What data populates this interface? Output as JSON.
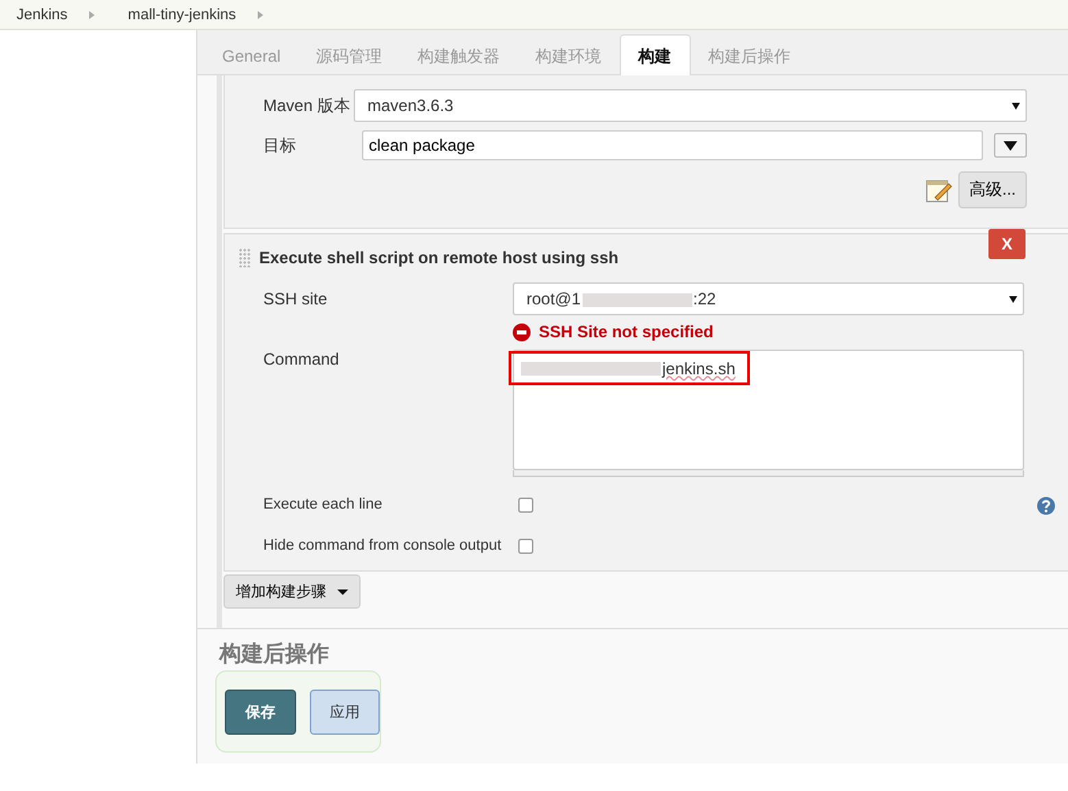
{
  "breadcrumbs": [
    "Jenkins",
    "mall-tiny-jenkins"
  ],
  "tabs": [
    {
      "label": "General",
      "selected": false
    },
    {
      "label": "源码管理",
      "selected": false
    },
    {
      "label": "构建触发器",
      "selected": false
    },
    {
      "label": "构建环境",
      "selected": false
    },
    {
      "label": "构建",
      "selected": true
    },
    {
      "label": "构建后操作",
      "selected": false
    }
  ],
  "maven": {
    "version_label": "Maven 版本",
    "version": "maven3.6.3",
    "goals_label": "目标",
    "goals": "clean package",
    "advanced": "高级..."
  },
  "shell_step": {
    "title": "Execute shell script on remote host using ssh",
    "delete": "X",
    "ssh_label": "SSH site",
    "ssh_prefix": "root@1",
    "ssh_suffix": ":22",
    "error": "SSH Site not specified",
    "command_label": "Command",
    "command_suffix": "jenkins.sh",
    "options": [
      {
        "label": "Execute each line",
        "checked": false
      },
      {
        "label": "Hide command from console output",
        "checked": false
      }
    ]
  },
  "add_step": "增加构建步骤",
  "post_build_heading": "构建后操作",
  "buttons": [
    {
      "label": "保存",
      "kind": "primary"
    },
    {
      "label": "应用",
      "kind": "secondary"
    }
  ]
}
